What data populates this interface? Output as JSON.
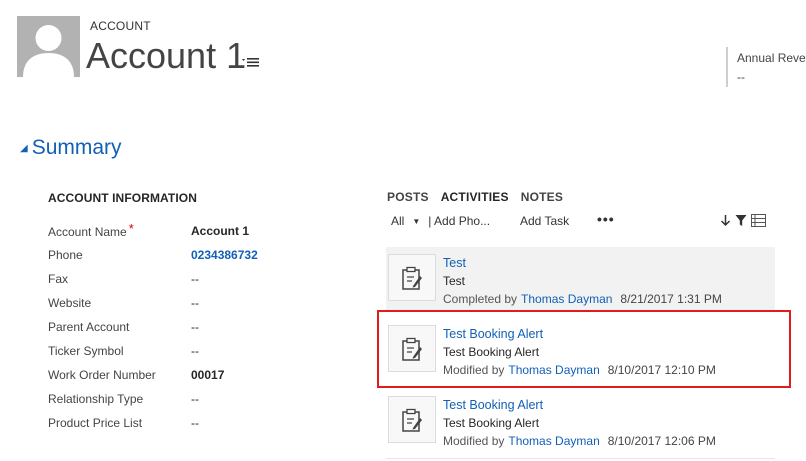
{
  "header": {
    "entity_type": "ACCOUNT",
    "title": "Account 1",
    "kpi_label": "Annual Reven",
    "kpi_value": "--"
  },
  "summary": {
    "section_title": "Summary",
    "info_heading": "ACCOUNT INFORMATION",
    "fields": [
      {
        "label": "Account Name",
        "value": "Account 1"
      },
      {
        "label": "Phone",
        "value": "0234386732"
      },
      {
        "label": "Fax",
        "value": "--"
      },
      {
        "label": "Website",
        "value": "--"
      },
      {
        "label": "Parent Account",
        "value": "--"
      },
      {
        "label": "Ticker Symbol",
        "value": "--"
      },
      {
        "label": "Work Order Number",
        "value": "00017"
      },
      {
        "label": "Relationship Type",
        "value": "--"
      },
      {
        "label": "Product Price List",
        "value": "--"
      }
    ],
    "required_marker": "*"
  },
  "social": {
    "tabs": [
      "POSTS",
      "ACTIVITIES",
      "NOTES"
    ],
    "toolbar": {
      "filter": "All",
      "add_phone": "| Add Pho...",
      "add_task": "Add Task",
      "more": "•••"
    },
    "activities": [
      {
        "title": "Test",
        "description": "Test",
        "status": "Completed by",
        "user": "Thomas Dayman",
        "timestamp": "8/21/2017 1:31 PM"
      },
      {
        "title": "Test Booking Alert",
        "description": "Test Booking Alert",
        "status": "Modified by",
        "user": "Thomas Dayman",
        "timestamp": "8/10/2017 12:10 PM"
      },
      {
        "title": "Test Booking Alert",
        "description": "Test Booking Alert",
        "status": "Modified by",
        "user": "Thomas Dayman",
        "timestamp": "8/10/2017 12:06 PM"
      }
    ]
  },
  "colors": {
    "link": "#1160b7",
    "highlight": "#e01c1c",
    "required": "#d20000"
  }
}
